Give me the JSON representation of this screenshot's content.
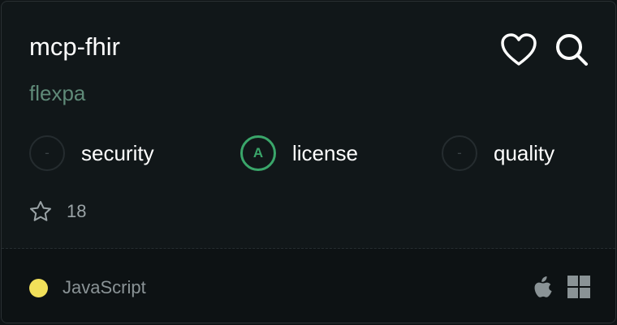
{
  "repo": {
    "name": "mcp-fhir",
    "owner": "flexpa"
  },
  "actions": {
    "favorite_icon": "heart-icon",
    "search_icon": "search-icon"
  },
  "metrics": [
    {
      "symbol": "-",
      "label": "security",
      "status": "unknown"
    },
    {
      "symbol": "A",
      "label": "license",
      "status": "good"
    },
    {
      "symbol": "-",
      "label": "quality",
      "status": "unknown"
    }
  ],
  "stars": {
    "icon": "star-icon",
    "count": "18"
  },
  "footer": {
    "language": "JavaScript",
    "language_color": "#f1e05a",
    "platforms": [
      "apple-icon",
      "windows-icon"
    ]
  },
  "colors": {
    "accent_good": "#3aa66a",
    "owner": "#5f8a78"
  }
}
